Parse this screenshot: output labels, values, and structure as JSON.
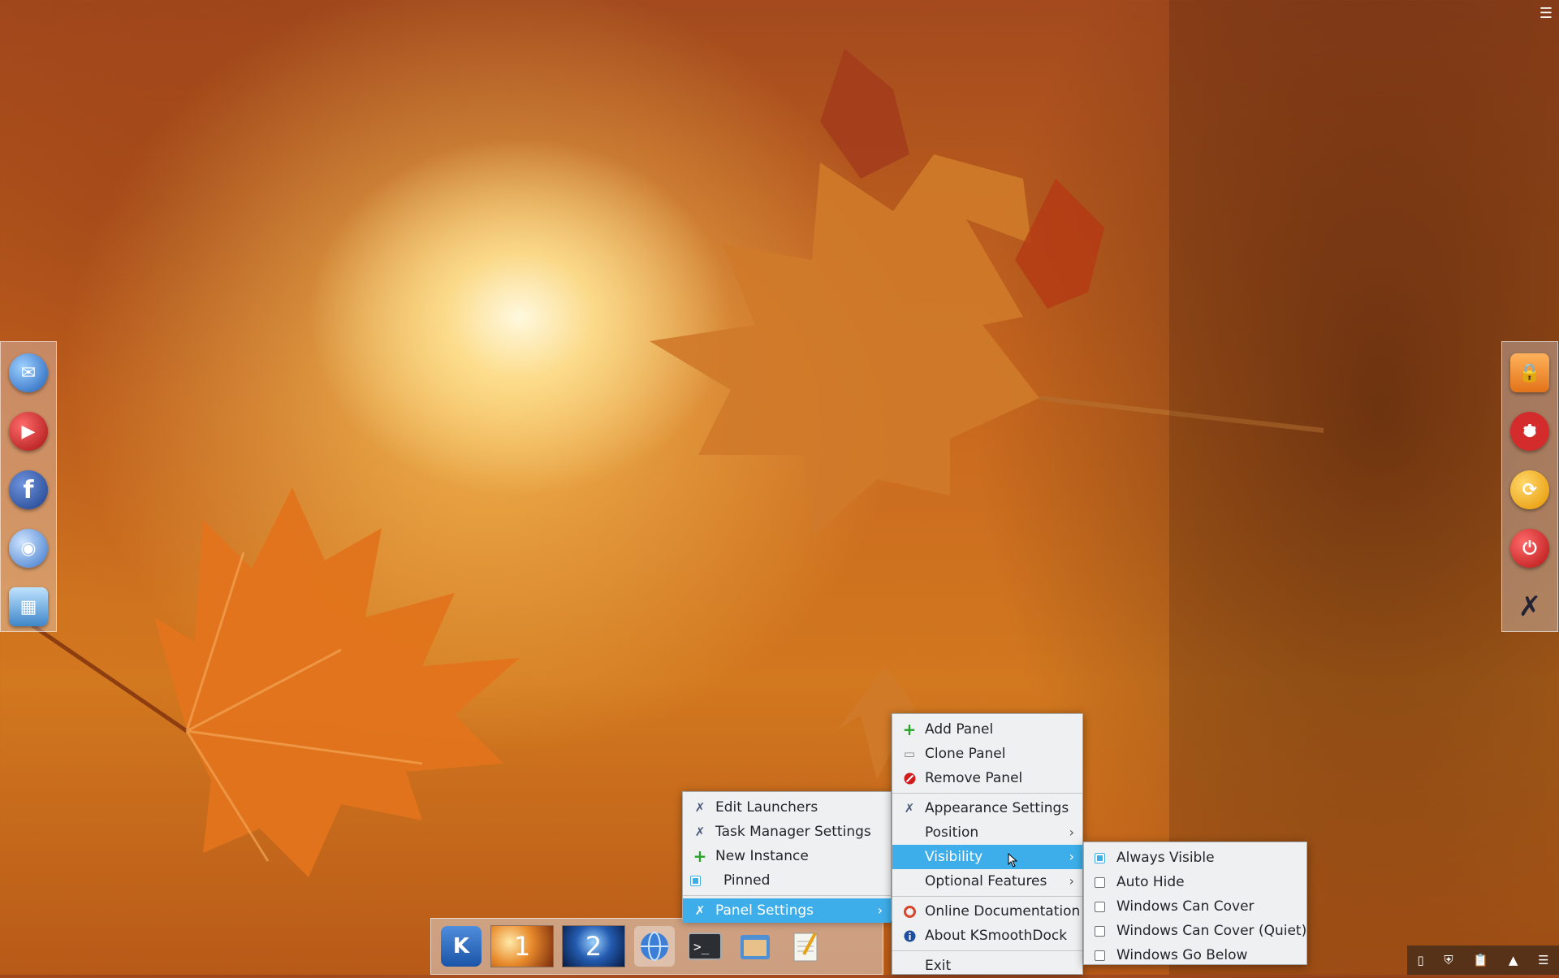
{
  "desktop": {
    "top_right_menu_icon": "hamburger-icon",
    "left_dock": {
      "items": [
        {
          "name": "mail-globe-icon",
          "color": "#2b6fc9"
        },
        {
          "name": "youtube-icon",
          "color": "#c2181b"
        },
        {
          "name": "facebook-icon",
          "color": "#2f56a4",
          "glyph": "f"
        },
        {
          "name": "network-globe-icon",
          "color": "#5b8fd9"
        },
        {
          "name": "photo-gallery-icon",
          "color": "#6aa6d6"
        }
      ]
    },
    "right_dock": {
      "items": [
        {
          "name": "lock-icon",
          "color": "#f08a2a"
        },
        {
          "name": "lifesaver-icon",
          "color": "#d42c2c"
        },
        {
          "name": "refresh-icon",
          "color": "#f3a90e"
        },
        {
          "name": "power-icon",
          "color": "#d42222"
        },
        {
          "name": "settings-tools-icon",
          "color": "#4a6fa5"
        }
      ]
    }
  },
  "taskbar": {
    "kde_label": "K",
    "desktops": [
      {
        "label": "1"
      },
      {
        "label": "2"
      }
    ],
    "apps": [
      "browser-globe-icon",
      "terminal-icon",
      "file-manager-icon",
      "text-editor-icon"
    ]
  },
  "tray": {
    "icons": [
      "usb-drive-icon",
      "shield-icon",
      "clipboard-icon",
      "expand-arrow-icon",
      "tray-menu-icon"
    ]
  },
  "context_menu": {
    "items": [
      {
        "label": "Edit Launchers",
        "icon": "tools-icon"
      },
      {
        "label": "Task Manager Settings",
        "icon": "tools-icon"
      },
      {
        "label": "New Instance",
        "icon": "plus-icon"
      },
      {
        "label": "Pinned",
        "icon": "checkbox",
        "checked": true
      },
      {
        "label": "Panel Settings",
        "icon": "tools-icon",
        "highlighted": true,
        "submenu": true
      }
    ]
  },
  "panel_settings_menu": {
    "items": [
      {
        "label": "Add Panel",
        "icon": "plus-icon"
      },
      {
        "label": "Clone Panel",
        "icon": "document-icon"
      },
      {
        "label": "Remove Panel",
        "icon": "remove-icon"
      },
      {
        "label": "Appearance Settings",
        "icon": "tools-icon"
      },
      {
        "label": "Position",
        "submenu": true
      },
      {
        "label": "Visibility",
        "submenu": true,
        "highlighted": true
      },
      {
        "label": "Optional Features",
        "submenu": true
      },
      {
        "label": "Online Documentation",
        "icon": "help-icon"
      },
      {
        "label": "About KSmoothDock",
        "icon": "info-icon"
      },
      {
        "label": "Exit"
      }
    ]
  },
  "visibility_menu": {
    "items": [
      {
        "label": "Always Visible",
        "checked": true
      },
      {
        "label": "Auto Hide",
        "checked": false
      },
      {
        "label": "Windows Can Cover",
        "checked": false
      },
      {
        "label": "Windows Can Cover (Quiet)",
        "checked": false
      },
      {
        "label": "Windows Go Below",
        "checked": false
      }
    ]
  },
  "colors": {
    "highlight": "#3daee9",
    "menu_bg": "#eff0f1"
  }
}
